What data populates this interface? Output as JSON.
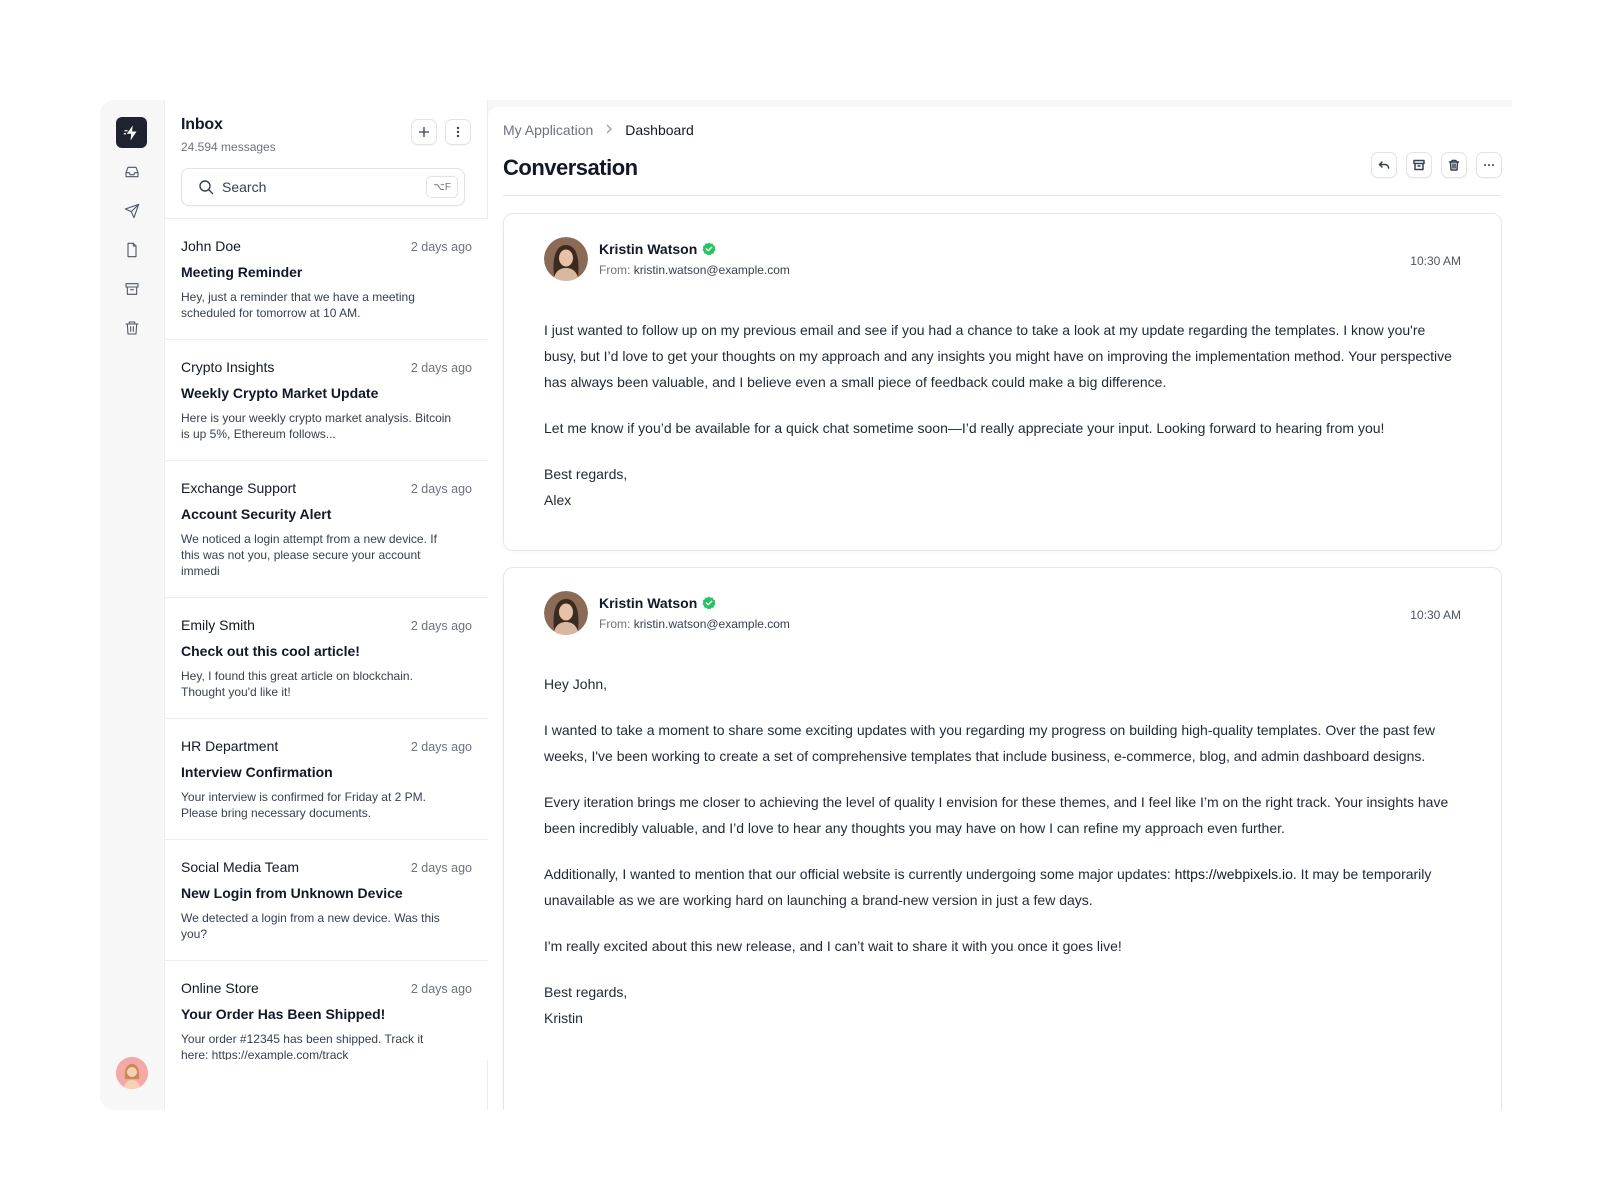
{
  "inbox": {
    "title": "Inbox",
    "count": "24.594 messages",
    "search_placeholder": "Search",
    "search_shortcut": "⌥F",
    "items": [
      {
        "sender": "John Doe",
        "time": "2 days ago",
        "subject": "Meeting Reminder",
        "preview": "Hey, just a reminder that we have a meeting scheduled for tomorrow at 10 AM."
      },
      {
        "sender": "Crypto Insights",
        "time": "2 days ago",
        "subject": "Weekly Crypto Market Update",
        "preview": "Here is your weekly crypto market analysis. Bitcoin is up 5%, Ethereum follows..."
      },
      {
        "sender": "Exchange Support",
        "time": "2 days ago",
        "subject": "Account Security Alert",
        "preview": "We noticed a login attempt from a new device. If this was not you, please secure your account immedi"
      },
      {
        "sender": "Emily Smith",
        "time": "2 days ago",
        "subject": "Check out this cool article!",
        "preview": "Hey, I found this great article on blockchain. Thought you'd like it!"
      },
      {
        "sender": "HR Department",
        "time": "2 days ago",
        "subject": "Interview Confirmation",
        "preview": "Your interview is confirmed for Friday at 2 PM. Please bring necessary documents."
      },
      {
        "sender": "Social Media Team",
        "time": "2 days ago",
        "subject": "New Login from Unknown Device",
        "preview": "We detected a login from a new device. Was this you?"
      },
      {
        "sender": "Online Store",
        "time": "2 days ago",
        "subject": "Your Order Has Been Shipped!",
        "preview": "Your order #12345 has been shipped. Track it here: https://example.com/track"
      }
    ]
  },
  "breadcrumb": {
    "parent": "My Application",
    "current": "Dashboard"
  },
  "page_title": "Conversation",
  "messages": [
    {
      "name": "Kristin Watson",
      "from_label": "From:",
      "from_email": "kristin.watson@example.com",
      "time": "10:30 AM",
      "paragraphs": [
        "I just wanted to follow up on my previous email and see if you had a chance to take a look at my update regarding the templates. I know you're busy, but I’d love to get your thoughts on my approach and any insights you might have on improving the implementation method. Your perspective has always been valuable, and I believe even a small piece of feedback could make a big difference.",
        "Let me know if you’d be available for a quick chat sometime soon—I’d really appreciate your input. Looking forward to hearing from you!"
      ],
      "closing": "Best regards,",
      "signature": "Alex"
    },
    {
      "name": "Kristin Watson",
      "from_label": "From:",
      "from_email": "kristin.watson@example.com",
      "time": "10:30 AM",
      "greeting": "Hey John,",
      "paragraphs": [
        "I wanted to take a moment to share some exciting updates with you regarding my progress on building high-quality templates. Over the past few weeks, I've been working to create a set of comprehensive templates that include business, e-commerce, blog, and admin dashboard designs.",
        "Every iteration brings me closer to achieving the level of quality I envision for these themes, and I feel like I’m on the right track. Your insights have been incredibly valuable, and I’d love to hear any thoughts you may have on how I can refine my approach even further."
      ],
      "p3_before": "Additionally, I wanted to mention that our official website is currently undergoing some major updates: ",
      "p3_link": "https://webpixels.io",
      "p3_after": ". It may be temporarily unavailable as we are working hard on launching a brand-new version in just a few days.",
      "p4": "I'm really excited about this new release, and I can’t wait to share it with you once it goes live!",
      "closing": "Best regards,",
      "signature": "Kristin"
    }
  ],
  "colors": {
    "logo_bg": "#1f2330",
    "verified": "#22c55e",
    "avatar_bg": "#f4a9a8"
  },
  "icons": [
    "bolt-icon",
    "inbox-icon",
    "send-icon",
    "file-icon",
    "archive-icon",
    "trash-icon",
    "plus-icon",
    "more-vertical-icon",
    "search-icon",
    "reply-icon",
    "more-horizontal-icon",
    "verified-icon",
    "chevron-right-icon"
  ]
}
